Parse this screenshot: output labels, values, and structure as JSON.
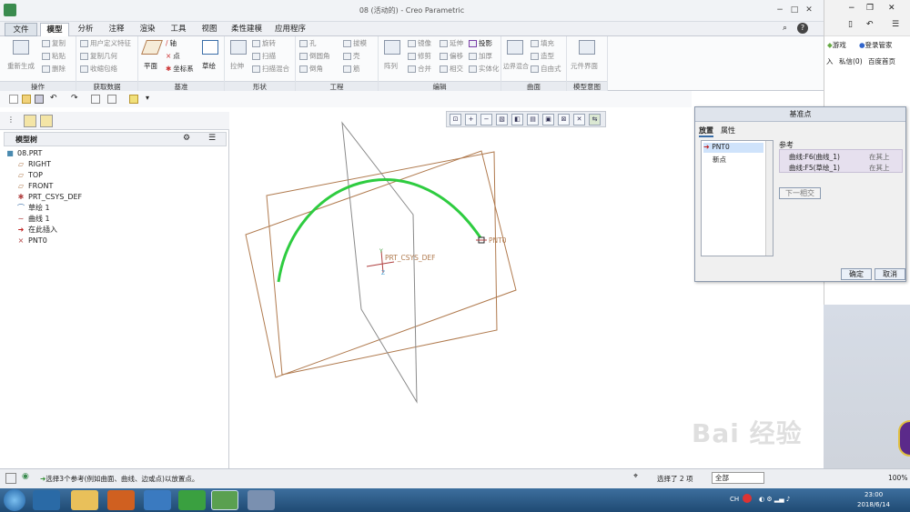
{
  "window": {
    "title": "08 (活动的) - Creo Parametric"
  },
  "file_menu": "文件",
  "tabs": [
    "模型",
    "分析",
    "注释",
    "渲染",
    "工具",
    "视图",
    "柔性建模",
    "应用程序"
  ],
  "ribbon": {
    "groups": [
      {
        "label": "操作",
        "items": [
          "重新生成",
          "复制",
          "粘贴",
          "删除"
        ]
      },
      {
        "label": "获取数据",
        "items": [
          "用户定义特征",
          "复制几何",
          "收缩包络"
        ]
      },
      {
        "label": "基准",
        "items": [
          "平面",
          "轴",
          "点",
          "坐标系",
          "草绘"
        ]
      },
      {
        "label": "形状",
        "items": [
          "拉伸",
          "旋转",
          "扫描",
          "扫描混合"
        ]
      },
      {
        "label": "工程",
        "items": [
          "孔",
          "倒圆角",
          "倒角",
          "拔模",
          "壳",
          "筋"
        ]
      },
      {
        "label": "编辑",
        "items": [
          "阵列",
          "镜像",
          "修剪",
          "合并",
          "延伸",
          "偏移",
          "相交",
          "投影",
          "加厚",
          "实体化"
        ]
      },
      {
        "label": "曲面",
        "items": [
          "边界混合",
          "填充",
          "造型",
          "自由式"
        ]
      },
      {
        "label": "模型意图",
        "items": [
          "元件界面"
        ]
      }
    ]
  },
  "model_tree": {
    "header": "模型树",
    "items": [
      {
        "label": "08.PRT",
        "icon": "part-icon"
      },
      {
        "label": "RIGHT",
        "icon": "datum-plane-icon"
      },
      {
        "label": "TOP",
        "icon": "datum-plane-icon"
      },
      {
        "label": "FRONT",
        "icon": "datum-plane-icon"
      },
      {
        "label": "PRT_CSYS_DEF",
        "icon": "csys-icon"
      },
      {
        "label": "草绘 1",
        "icon": "sketch-icon"
      },
      {
        "label": "曲线 1",
        "icon": "curve-icon"
      },
      {
        "label": "在此插入",
        "icon": "insert-arrow-icon"
      },
      {
        "label": "PNT0",
        "icon": "datum-point-icon"
      }
    ]
  },
  "canvas": {
    "csys_label": "PRT_CSYS_DEF",
    "point_label": "PNT0",
    "colors": {
      "curve": "#2ecc40",
      "plane": "#b07a4e",
      "plane_gray": "#8a8a8a"
    }
  },
  "dialog": {
    "title": "基准点",
    "tabs": [
      "放置",
      "属性"
    ],
    "points": [
      "PNT0",
      "新点"
    ],
    "refs_label": "参考",
    "refs": [
      {
        "name": "曲线:F6(曲线_1)",
        "type": "在其上"
      },
      {
        "name": "曲线:F5(草绘_1)",
        "type": "在其上"
      }
    ],
    "next_btn": "下一相交",
    "ok": "确定",
    "cancel": "取消"
  },
  "right_panel": {
    "game": "游戏",
    "login": "登录管家",
    "links": [
      "入",
      "私信(0)",
      "百度首页"
    ]
  },
  "status": {
    "message": "选择3个参考(例如曲面、曲线、边或点)以放置点。",
    "selected": "选择了 2 项",
    "filter": "全部",
    "zoom": "100%"
  },
  "taskbar": {
    "lang": "CH",
    "time": "23:00",
    "date": "2018/6/14"
  },
  "watermark": "Bai 经验"
}
